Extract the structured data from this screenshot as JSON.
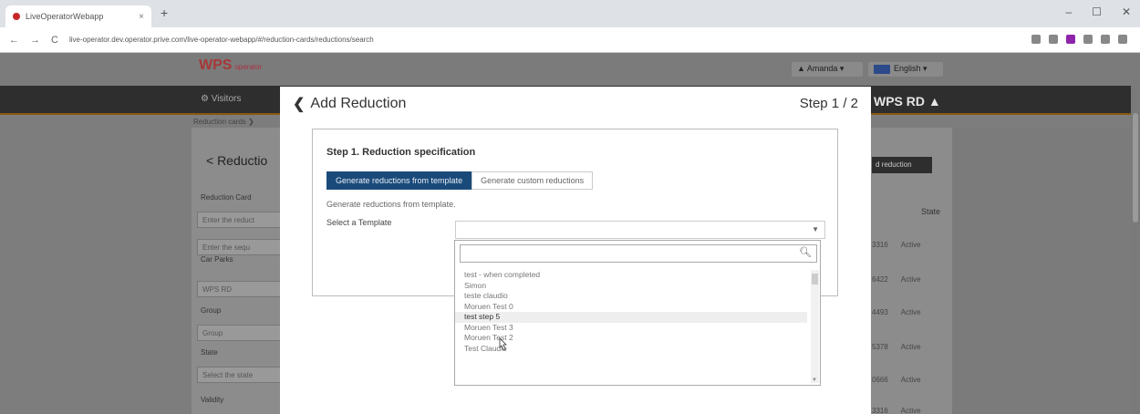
{
  "browser": {
    "tab_title": "LiveOperatorWebapp",
    "tab_close": "×",
    "new_tab": "+",
    "window_controls": [
      "–",
      "☐",
      "✕"
    ],
    "nav": [
      "←",
      "→",
      "C"
    ],
    "url": "live-operator.dev.operator.prive.com/live-operator-webapp/#/reduction-cards/reductions/search"
  },
  "app": {
    "brand": "WPS",
    "brand_sub": "operator",
    "user": "▲ Amanda ▾",
    "language": "English ▾",
    "nav_visitors": "⚙ Visitors",
    "nav_right": "WPS RD ▲",
    "breadcrumb": "Reduction cards ❯"
  },
  "left_panel": {
    "title": "< Reductio",
    "fields": [
      {
        "label": "Reduction Card",
        "placeholder": "Enter the reduct"
      },
      {
        "label": "",
        "placeholder": "Enter the sequ"
      },
      {
        "label": "Car Parks",
        "placeholder": "WPS RD"
      },
      {
        "label": "Group",
        "placeholder": "Group"
      },
      {
        "label": "State",
        "placeholder": "Select the state"
      },
      {
        "label": "Validity",
        "placeholder": ""
      }
    ]
  },
  "right_panel": {
    "add_button": "d reduction",
    "state_header": "State",
    "rows": [
      {
        "id": "3316",
        "state": "Active"
      },
      {
        "id": "6422",
        "state": "Active"
      },
      {
        "id": "4493",
        "state": "Active"
      },
      {
        "id": "5378",
        "state": "Active"
      },
      {
        "id": "0666",
        "state": "Active"
      },
      {
        "id": "3316",
        "state": "Active"
      }
    ]
  },
  "modal": {
    "title": "Add Reduction",
    "step": "Step 1 / 2",
    "section_title": "Step 1. Reduction specification",
    "tabs": {
      "from_template": "Generate reductions from template",
      "custom": "Generate custom reductions"
    },
    "description": "Generate reductions from template.",
    "select_label": "Select a Template",
    "dropdown": {
      "search_value": "",
      "options": [
        "test - when completed",
        "Simon",
        "teste claudio",
        "Moruen Test 0",
        "test step 5",
        "Moruen Test 3",
        "Moruen Test 2",
        "Test Claudio"
      ],
      "highlighted_index": 4
    }
  }
}
